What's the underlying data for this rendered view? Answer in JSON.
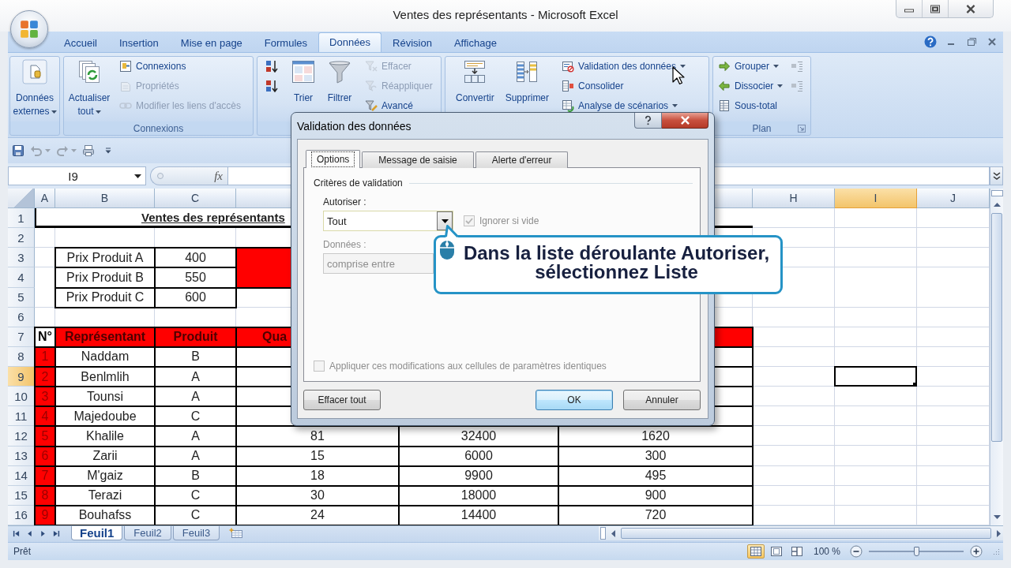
{
  "window": {
    "title": "Ventes des représentants - Microsoft Excel"
  },
  "ribbon_tabs": [
    {
      "label": "Accueil",
      "selected": false
    },
    {
      "label": "Insertion",
      "selected": false
    },
    {
      "label": "Mise en page",
      "selected": false
    },
    {
      "label": "Formules",
      "selected": false
    },
    {
      "label": "Données",
      "selected": true
    },
    {
      "label": "Révision",
      "selected": false
    },
    {
      "label": "Affichage",
      "selected": false
    }
  ],
  "ribbon_groups": [
    {
      "items": [
        {
          "kind": "large",
          "label": "Données externes",
          "dropdown": true,
          "disabled": false
        }
      ]
    },
    {
      "label": "Connexions",
      "items": [
        {
          "kind": "large",
          "label": "Actualiser tout",
          "dropdown": true,
          "disabled": false
        },
        {
          "kind": "small",
          "label": "Connexions",
          "dropdown": false,
          "disabled": false
        },
        {
          "kind": "small",
          "label": "Propriétés",
          "dropdown": false,
          "disabled": true
        },
        {
          "kind": "small",
          "label": "Modifier les liens d'accès",
          "dropdown": false,
          "disabled": true
        }
      ]
    },
    {
      "items": [
        {
          "kind": "icon",
          "dropdown": false,
          "disabled": false
        },
        {
          "kind": "icon",
          "dropdown": false,
          "disabled": false
        },
        {
          "kind": "large",
          "label": "Trier",
          "dropdown": false,
          "disabled": false
        },
        {
          "kind": "large",
          "label": "Filtrer",
          "dropdown": false,
          "disabled": false
        },
        {
          "kind": "small",
          "label": "Effacer",
          "dropdown": false,
          "disabled": true
        },
        {
          "kind": "small",
          "label": "Réappliquer",
          "dropdown": false,
          "disabled": true
        },
        {
          "kind": "small",
          "label": "Avancé",
          "dropdown": false,
          "disabled": false
        }
      ]
    },
    {
      "items": [
        {
          "kind": "large",
          "label": "Convertir",
          "dropdown": false,
          "disabled": false
        },
        {
          "kind": "large",
          "label": "Supprimer",
          "dropdown": false,
          "disabled": false
        },
        {
          "kind": "small",
          "label": "Validation des données",
          "dropdown": true,
          "disabled": false
        },
        {
          "kind": "small",
          "label": "Consolider",
          "dropdown": false,
          "disabled": false
        },
        {
          "kind": "small",
          "label": "Analyse de scénarios",
          "dropdown": true,
          "disabled": false
        }
      ]
    },
    {
      "label": "Plan",
      "items": [
        {
          "kind": "small",
          "label": "Grouper",
          "dropdown": true,
          "disabled": false
        },
        {
          "kind": "small",
          "label": "Dissocier",
          "dropdown": true,
          "disabled": false
        },
        {
          "kind": "small",
          "label": "Sous-total",
          "dropdown": false,
          "disabled": false
        },
        {
          "kind": "icon",
          "dropdown": false,
          "disabled": false
        },
        {
          "kind": "icon",
          "dropdown": false,
          "disabled": false
        }
      ]
    }
  ],
  "formula_bar": {
    "name_box": "I9",
    "function_label": "fx"
  },
  "column_headers": [
    {
      "label": "A",
      "selected": false
    },
    {
      "label": "B",
      "selected": false
    },
    {
      "label": "C",
      "selected": false
    },
    {
      "label": "H",
      "selected": false
    },
    {
      "label": "I",
      "selected": true
    },
    {
      "label": "J",
      "selected": false
    }
  ],
  "row_headers": [
    {
      "label": "1",
      "selected": false
    },
    {
      "label": "2",
      "selected": false
    },
    {
      "label": "3",
      "selected": false
    },
    {
      "label": "4",
      "selected": false
    },
    {
      "label": "5",
      "selected": false
    },
    {
      "label": "6",
      "selected": false
    },
    {
      "label": "7",
      "selected": false
    },
    {
      "label": "8",
      "selected": false
    },
    {
      "label": "9",
      "selected": true
    },
    {
      "label": "10",
      "selected": false
    },
    {
      "label": "11",
      "selected": false
    },
    {
      "label": "12",
      "selected": false
    },
    {
      "label": "13",
      "selected": false
    },
    {
      "label": "14",
      "selected": false
    },
    {
      "label": "15",
      "selected": false
    },
    {
      "label": "16",
      "selected": false
    }
  ],
  "sheet_title": "Ventes des représentants",
  "price_table": [
    {
      "label": "Prix Produit A",
      "value": "400"
    },
    {
      "label": "Prix Produit B",
      "value": "550"
    },
    {
      "label": "Prix Produit C",
      "value": "600"
    }
  ],
  "sales_table": {
    "headers": [
      {
        "text": "N°",
        "kind": "index"
      },
      {
        "text": "Représentant",
        "kind": "field"
      },
      {
        "text": "Produit",
        "kind": "field"
      },
      {
        "text": "Qua",
        "kind": "field"
      }
    ],
    "rows": [
      {
        "cells": [
          "1",
          "Naddam",
          "B"
        ]
      },
      {
        "cells": [
          "2",
          "Benlmlih",
          "A"
        ]
      },
      {
        "cells": [
          "3",
          "Tounsi",
          "A"
        ]
      },
      {
        "cells": [
          "4",
          "Majedoube",
          "C"
        ]
      },
      {
        "cells": [
          "5",
          "Khalile",
          "A",
          "81",
          "32400",
          "1620"
        ]
      },
      {
        "cells": [
          "6",
          "Zarii",
          "A",
          "15",
          "6000",
          "300"
        ]
      },
      {
        "cells": [
          "7",
          "M'gaiz",
          "B",
          "18",
          "9900",
          "495"
        ]
      },
      {
        "cells": [
          "8",
          "Terazi",
          "C",
          "30",
          "18000",
          "900"
        ]
      },
      {
        "cells": [
          "9",
          "Bouhafss",
          "C",
          "24",
          "14400",
          "720"
        ]
      }
    ]
  },
  "sheet_tabs": [
    {
      "label": "Feuil1",
      "selected": true
    },
    {
      "label": "Feuil2",
      "selected": false
    },
    {
      "label": "Feuil3",
      "selected": false
    }
  ],
  "status_bar": {
    "status": "Prêt",
    "views": [
      {
        "selected": true
      },
      {
        "selected": false
      },
      {
        "selected": false
      }
    ],
    "zoom": "100 %",
    "zoom_slider": {
      "level": 0.5
    }
  },
  "dialog": {
    "title": "Validation des données",
    "tabs": [
      {
        "label": "Options",
        "selected": true
      },
      {
        "label": "Message de saisie",
        "selected": false
      },
      {
        "label": "Alerte d'erreur",
        "selected": false
      }
    ],
    "section_title": "Critères de validation",
    "allow": {
      "label": "Autoriser :",
      "value": "Tout"
    },
    "ignore_blank": {
      "label": "Ignorer si vide",
      "checked": true,
      "disabled": true
    },
    "data": {
      "label": "Données :",
      "value": "comprise entre",
      "disabled": true
    },
    "apply_all": {
      "label": "Appliquer ces modifications aux cellules de paramètres identiques",
      "checked": false,
      "disabled": true
    },
    "clear_button": "Effacer tout",
    "buttons": [
      {
        "label": "OK",
        "default": true
      },
      {
        "label": "Annuler",
        "default": false
      }
    ]
  },
  "callout": {
    "text": "Dans la liste déroulante Autoriser, sélectionnez Liste"
  }
}
